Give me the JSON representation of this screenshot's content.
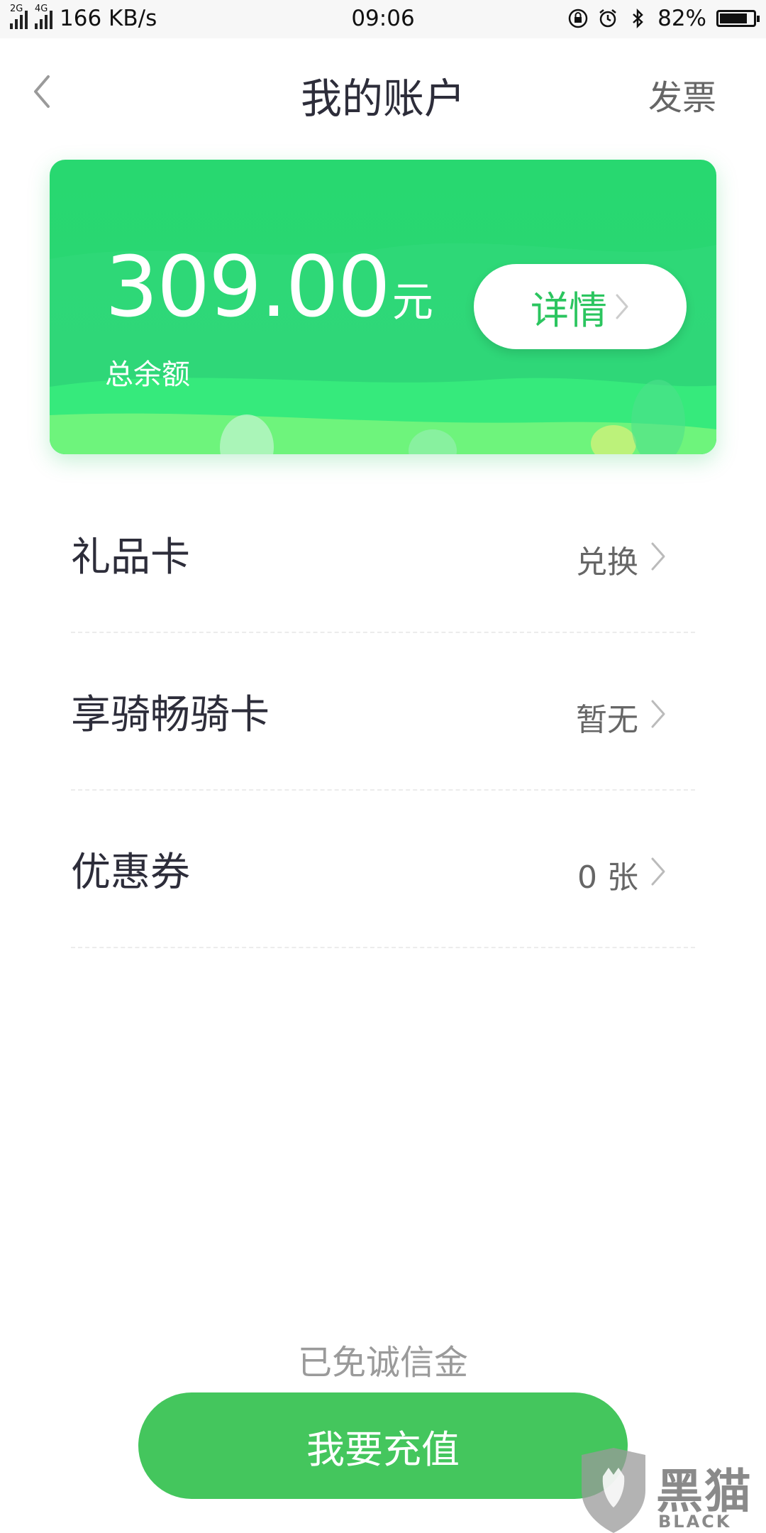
{
  "status_bar": {
    "network_speed": "166 KB/s",
    "time": "09:06",
    "battery": "82%",
    "battery_level": 0.82,
    "sim1_tag": "2G",
    "sim2_tag": "4G"
  },
  "header": {
    "title": "我的账户",
    "invoice": "发票"
  },
  "balance": {
    "amount": "309.00",
    "unit": "元",
    "label": "总余额",
    "detail_button": "详情"
  },
  "rows": [
    {
      "label": "礼品卡",
      "value": "兑换"
    },
    {
      "label": "享骑畅骑卡",
      "value": "暂无"
    },
    {
      "label": "优惠券",
      "value": "0 张"
    }
  ],
  "footer": {
    "deposit_status": "已免诚信金",
    "recharge_button": "我要充值"
  },
  "watermark": {
    "text": "黑猫",
    "subtext": "BLACK CAT"
  },
  "colors": {
    "brand_green": "#2bd575",
    "button_green": "#44c65d",
    "title_text": "#2d2d3a"
  }
}
